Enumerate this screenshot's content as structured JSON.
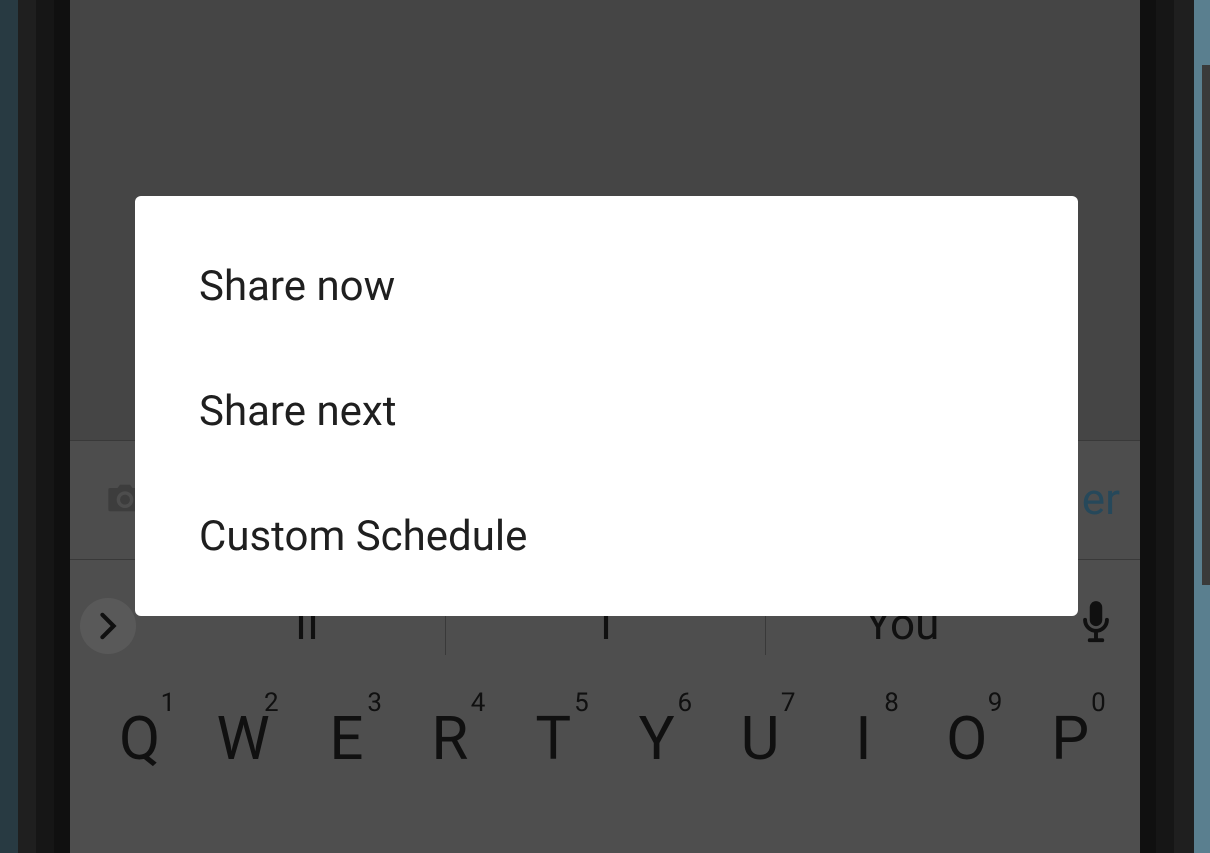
{
  "dialog": {
    "options": [
      "Share now",
      "Share next",
      "Custom Schedule"
    ]
  },
  "inputBar": {
    "bufferPartial": "er"
  },
  "keyboard": {
    "suggestions": [
      "II",
      "I",
      "You"
    ],
    "row1": [
      {
        "letter": "Q",
        "num": "1"
      },
      {
        "letter": "W",
        "num": "2"
      },
      {
        "letter": "E",
        "num": "3"
      },
      {
        "letter": "R",
        "num": "4"
      },
      {
        "letter": "T",
        "num": "5"
      },
      {
        "letter": "Y",
        "num": "6"
      },
      {
        "letter": "U",
        "num": "7"
      },
      {
        "letter": "I",
        "num": "8"
      },
      {
        "letter": "O",
        "num": "9"
      },
      {
        "letter": "P",
        "num": "0"
      }
    ]
  }
}
